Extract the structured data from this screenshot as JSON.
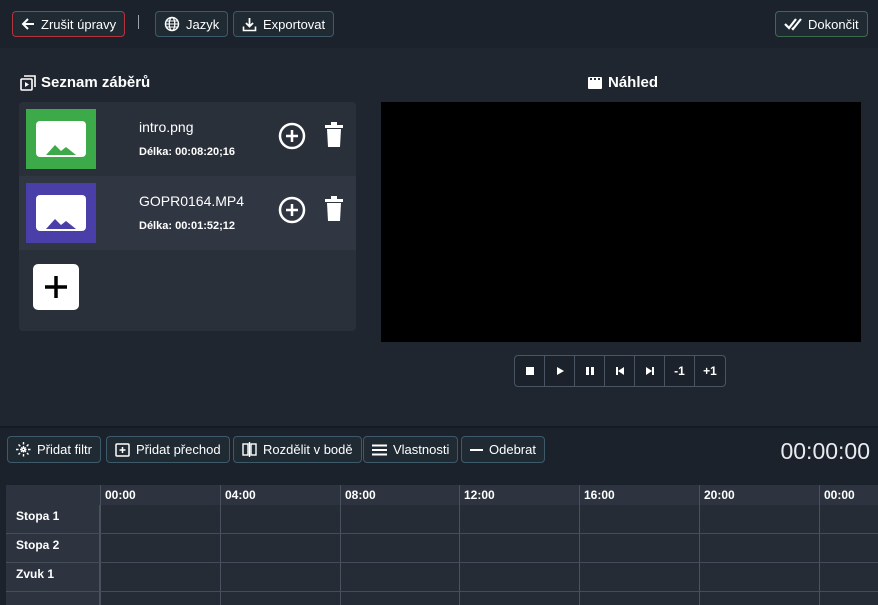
{
  "toolbar": {
    "cancel_label": "Zrušit úpravy",
    "language_label": "Jazyk",
    "export_label": "Exportovat",
    "finish_label": "Dokončit"
  },
  "clips_panel": {
    "title": "Seznam záběrů",
    "clips": [
      {
        "name": "intro.png",
        "length": "Délka: 00:08:20;16",
        "thumb_color": "#3daa4a"
      },
      {
        "name": "GOPR0164.MP4",
        "length": "Délka: 00:01:52;12",
        "thumb_color": "#4a3fa8"
      }
    ]
  },
  "preview": {
    "title": "Náhled"
  },
  "transport": {
    "minus_label": "-1",
    "plus_label": "+1"
  },
  "edit_toolbar": {
    "add_filter": "Přidat filtr",
    "add_transition": "Přidat přechod",
    "split_at_point": "Rozdělit v bodě",
    "properties": "Vlastnosti",
    "remove": "Odebrat",
    "timecode": "00:00:00"
  },
  "timeline": {
    "ticks": [
      "00:00",
      "04:00",
      "08:00",
      "12:00",
      "16:00",
      "20:00",
      "00:00"
    ],
    "tracks": [
      "Stopa 1",
      "Stopa 2",
      "Zvuk 1"
    ]
  },
  "colors": {
    "background": "#202630",
    "cancel_border": "#b3343d",
    "finish_border": "#3d6b4f",
    "button_border": "#3d5a6b"
  }
}
